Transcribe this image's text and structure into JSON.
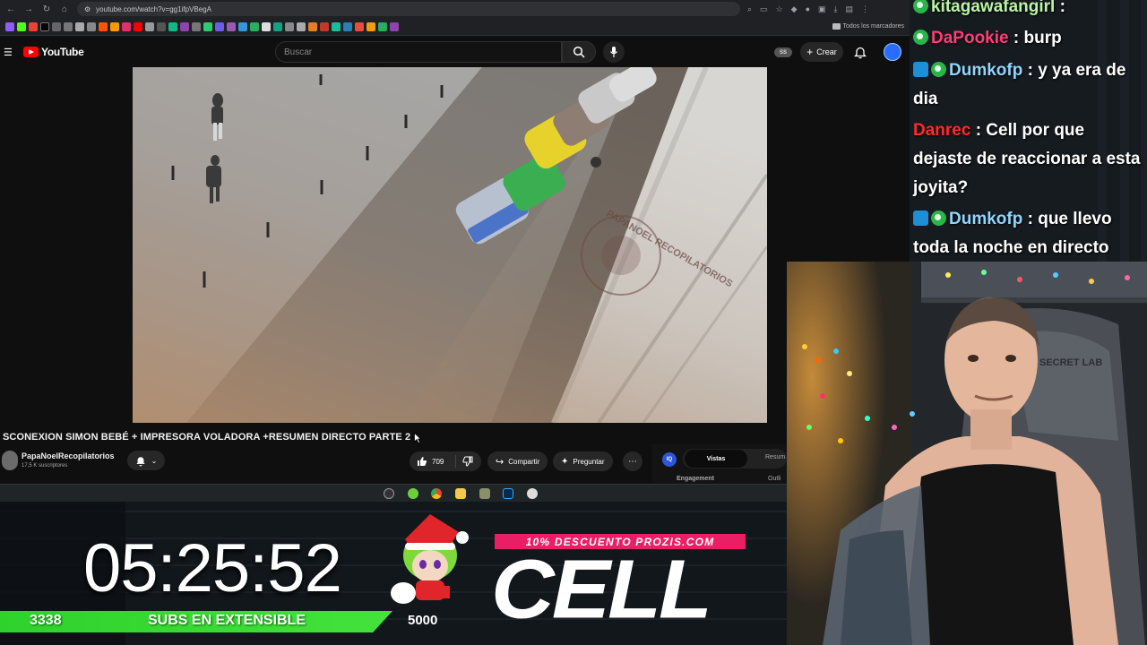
{
  "browser": {
    "url": "youtube.com/watch?v=gg1ifpVBegA",
    "bookmarks_folder": "Todos los marcadores"
  },
  "youtube": {
    "logo_text": "YouTube",
    "search_placeholder": "Buscar",
    "ss_badge": "SS",
    "create_label": "Crear",
    "video_title": "SCONEXION SIMON BEBÉ + IMPRESORA VOLADORA +RESUMEN DIRECTO PARTE 2",
    "watermark": "PAPANOEL RECOPILATORIOS",
    "channel": {
      "name": "PapaNoelRecopilatorios",
      "subs": "17,5 K suscriptores"
    },
    "likes": "709",
    "share_label": "Compartir",
    "ask_label": "Preguntar",
    "panel": {
      "logo": "IQ",
      "tab_active": "Vistas",
      "tab_other": "Resum",
      "engagement": "Engagement",
      "outlier": "Outli"
    }
  },
  "overlay": {
    "timer": "05:25:52",
    "subs_current": "3338",
    "subs_label": "SUBS EN EXTENSIBLE",
    "subs_goal": "5000",
    "promo": "10% DESCUENTO PROZIS.COM",
    "brand": "CELL",
    "chair_text": "SECRET LAB"
  },
  "chat": [
    {
      "user": "kitagawafangirl",
      "text": " :",
      "badges": [
        "sub"
      ],
      "color": "green"
    },
    {
      "user": "DaPookie",
      "text": " : burp",
      "badges": [
        "sub"
      ],
      "color": "pink"
    },
    {
      "user": "Dumkofp",
      "text": " : y ya era de dia",
      "badges": [
        "prime",
        "sub"
      ],
      "color": "blue"
    },
    {
      "user": "Danrec",
      "text": " : Cell por que dejaste de reaccionar a esta joyita?",
      "badges": [],
      "color": "red"
    },
    {
      "user": "Dumkofp",
      "text": " : que llevo toda la noche en directo",
      "badges": [
        "prime",
        "sub"
      ],
      "color": "blue"
    }
  ]
}
